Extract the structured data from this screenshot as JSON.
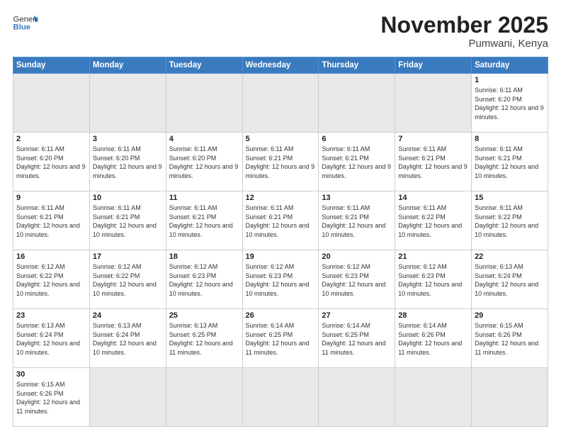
{
  "header": {
    "logo_general": "General",
    "logo_blue": "Blue",
    "month_title": "November 2025",
    "location": "Pumwani, Kenya"
  },
  "days_of_week": [
    "Sunday",
    "Monday",
    "Tuesday",
    "Wednesday",
    "Thursday",
    "Friday",
    "Saturday"
  ],
  "weeks": [
    [
      {
        "day": "",
        "info": ""
      },
      {
        "day": "",
        "info": ""
      },
      {
        "day": "",
        "info": ""
      },
      {
        "day": "",
        "info": ""
      },
      {
        "day": "",
        "info": ""
      },
      {
        "day": "",
        "info": ""
      },
      {
        "day": "1",
        "info": "Sunrise: 6:11 AM\nSunset: 6:20 PM\nDaylight: 12 hours and 9 minutes."
      }
    ],
    [
      {
        "day": "2",
        "info": "Sunrise: 6:11 AM\nSunset: 6:20 PM\nDaylight: 12 hours and 9 minutes."
      },
      {
        "day": "3",
        "info": "Sunrise: 6:11 AM\nSunset: 6:20 PM\nDaylight: 12 hours and 9 minutes."
      },
      {
        "day": "4",
        "info": "Sunrise: 6:11 AM\nSunset: 6:20 PM\nDaylight: 12 hours and 9 minutes."
      },
      {
        "day": "5",
        "info": "Sunrise: 6:11 AM\nSunset: 6:21 PM\nDaylight: 12 hours and 9 minutes."
      },
      {
        "day": "6",
        "info": "Sunrise: 6:11 AM\nSunset: 6:21 PM\nDaylight: 12 hours and 9 minutes."
      },
      {
        "day": "7",
        "info": "Sunrise: 6:11 AM\nSunset: 6:21 PM\nDaylight: 12 hours and 9 minutes."
      },
      {
        "day": "8",
        "info": "Sunrise: 6:11 AM\nSunset: 6:21 PM\nDaylight: 12 hours and 10 minutes."
      }
    ],
    [
      {
        "day": "9",
        "info": "Sunrise: 6:11 AM\nSunset: 6:21 PM\nDaylight: 12 hours and 10 minutes."
      },
      {
        "day": "10",
        "info": "Sunrise: 6:11 AM\nSunset: 6:21 PM\nDaylight: 12 hours and 10 minutes."
      },
      {
        "day": "11",
        "info": "Sunrise: 6:11 AM\nSunset: 6:21 PM\nDaylight: 12 hours and 10 minutes."
      },
      {
        "day": "12",
        "info": "Sunrise: 6:11 AM\nSunset: 6:21 PM\nDaylight: 12 hours and 10 minutes."
      },
      {
        "day": "13",
        "info": "Sunrise: 6:11 AM\nSunset: 6:21 PM\nDaylight: 12 hours and 10 minutes."
      },
      {
        "day": "14",
        "info": "Sunrise: 6:11 AM\nSunset: 6:22 PM\nDaylight: 12 hours and 10 minutes."
      },
      {
        "day": "15",
        "info": "Sunrise: 6:11 AM\nSunset: 6:22 PM\nDaylight: 12 hours and 10 minutes."
      }
    ],
    [
      {
        "day": "16",
        "info": "Sunrise: 6:12 AM\nSunset: 6:22 PM\nDaylight: 12 hours and 10 minutes."
      },
      {
        "day": "17",
        "info": "Sunrise: 6:12 AM\nSunset: 6:22 PM\nDaylight: 12 hours and 10 minutes."
      },
      {
        "day": "18",
        "info": "Sunrise: 6:12 AM\nSunset: 6:23 PM\nDaylight: 12 hours and 10 minutes."
      },
      {
        "day": "19",
        "info": "Sunrise: 6:12 AM\nSunset: 6:23 PM\nDaylight: 12 hours and 10 minutes."
      },
      {
        "day": "20",
        "info": "Sunrise: 6:12 AM\nSunset: 6:23 PM\nDaylight: 12 hours and 10 minutes."
      },
      {
        "day": "21",
        "info": "Sunrise: 6:12 AM\nSunset: 6:23 PM\nDaylight: 12 hours and 10 minutes."
      },
      {
        "day": "22",
        "info": "Sunrise: 6:13 AM\nSunset: 6:24 PM\nDaylight: 12 hours and 10 minutes."
      }
    ],
    [
      {
        "day": "23",
        "info": "Sunrise: 6:13 AM\nSunset: 6:24 PM\nDaylight: 12 hours and 10 minutes."
      },
      {
        "day": "24",
        "info": "Sunrise: 6:13 AM\nSunset: 6:24 PM\nDaylight: 12 hours and 10 minutes."
      },
      {
        "day": "25",
        "info": "Sunrise: 6:13 AM\nSunset: 6:25 PM\nDaylight: 12 hours and 11 minutes."
      },
      {
        "day": "26",
        "info": "Sunrise: 6:14 AM\nSunset: 6:25 PM\nDaylight: 12 hours and 11 minutes."
      },
      {
        "day": "27",
        "info": "Sunrise: 6:14 AM\nSunset: 6:25 PM\nDaylight: 12 hours and 11 minutes."
      },
      {
        "day": "28",
        "info": "Sunrise: 6:14 AM\nSunset: 6:26 PM\nDaylight: 12 hours and 11 minutes."
      },
      {
        "day": "29",
        "info": "Sunrise: 6:15 AM\nSunset: 6:26 PM\nDaylight: 12 hours and 11 minutes."
      }
    ],
    [
      {
        "day": "30",
        "info": "Sunrise: 6:15 AM\nSunset: 6:26 PM\nDaylight: 12 hours and 11 minutes."
      },
      {
        "day": "",
        "info": ""
      },
      {
        "day": "",
        "info": ""
      },
      {
        "day": "",
        "info": ""
      },
      {
        "day": "",
        "info": ""
      },
      {
        "day": "",
        "info": ""
      },
      {
        "day": "",
        "info": ""
      }
    ]
  ]
}
